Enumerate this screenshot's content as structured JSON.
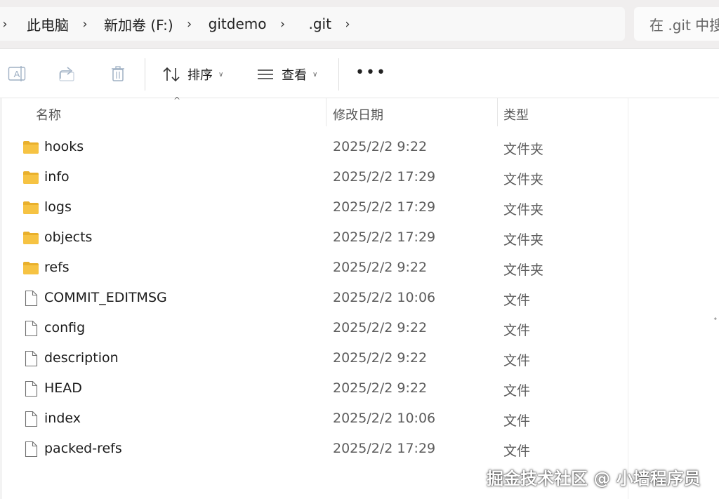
{
  "breadcrumb": {
    "items": [
      "此电脑",
      "新加卷 (F:)",
      "gitdemo",
      ".git"
    ],
    "separator": "›"
  },
  "search": {
    "placeholder": "在 .git 中搜"
  },
  "toolbar": {
    "rename_icon": "rename-icon",
    "share_icon": "share-icon",
    "delete_icon": "delete-icon",
    "sort_label": "排序",
    "view_label": "查看",
    "more_label": "•••"
  },
  "columns": {
    "name": "名称",
    "date": "修改日期",
    "type": "类型"
  },
  "files": [
    {
      "name": "hooks",
      "date": "2025/2/2 9:22",
      "type": "文件夹",
      "kind": "folder"
    },
    {
      "name": "info",
      "date": "2025/2/2 17:29",
      "type": "文件夹",
      "kind": "folder"
    },
    {
      "name": "logs",
      "date": "2025/2/2 17:29",
      "type": "文件夹",
      "kind": "folder"
    },
    {
      "name": "objects",
      "date": "2025/2/2 17:29",
      "type": "文件夹",
      "kind": "folder"
    },
    {
      "name": "refs",
      "date": "2025/2/2 9:22",
      "type": "文件夹",
      "kind": "folder"
    },
    {
      "name": "COMMIT_EDITMSG",
      "date": "2025/2/2 10:06",
      "type": "文件",
      "kind": "file"
    },
    {
      "name": "config",
      "date": "2025/2/2 9:22",
      "type": "文件",
      "kind": "file"
    },
    {
      "name": "description",
      "date": "2025/2/2 9:22",
      "type": "文件",
      "kind": "file"
    },
    {
      "name": "HEAD",
      "date": "2025/2/2 9:22",
      "type": "文件",
      "kind": "file"
    },
    {
      "name": "index",
      "date": "2025/2/2 10:06",
      "type": "文件",
      "kind": "file"
    },
    {
      "name": "packed-refs",
      "date": "2025/2/2 17:29",
      "type": "文件",
      "kind": "file"
    }
  ],
  "colors": {
    "folder": "#f6c343",
    "folder_dark": "#e9b02c"
  },
  "watermark": "掘金技术社区 @ 小墙程序员"
}
